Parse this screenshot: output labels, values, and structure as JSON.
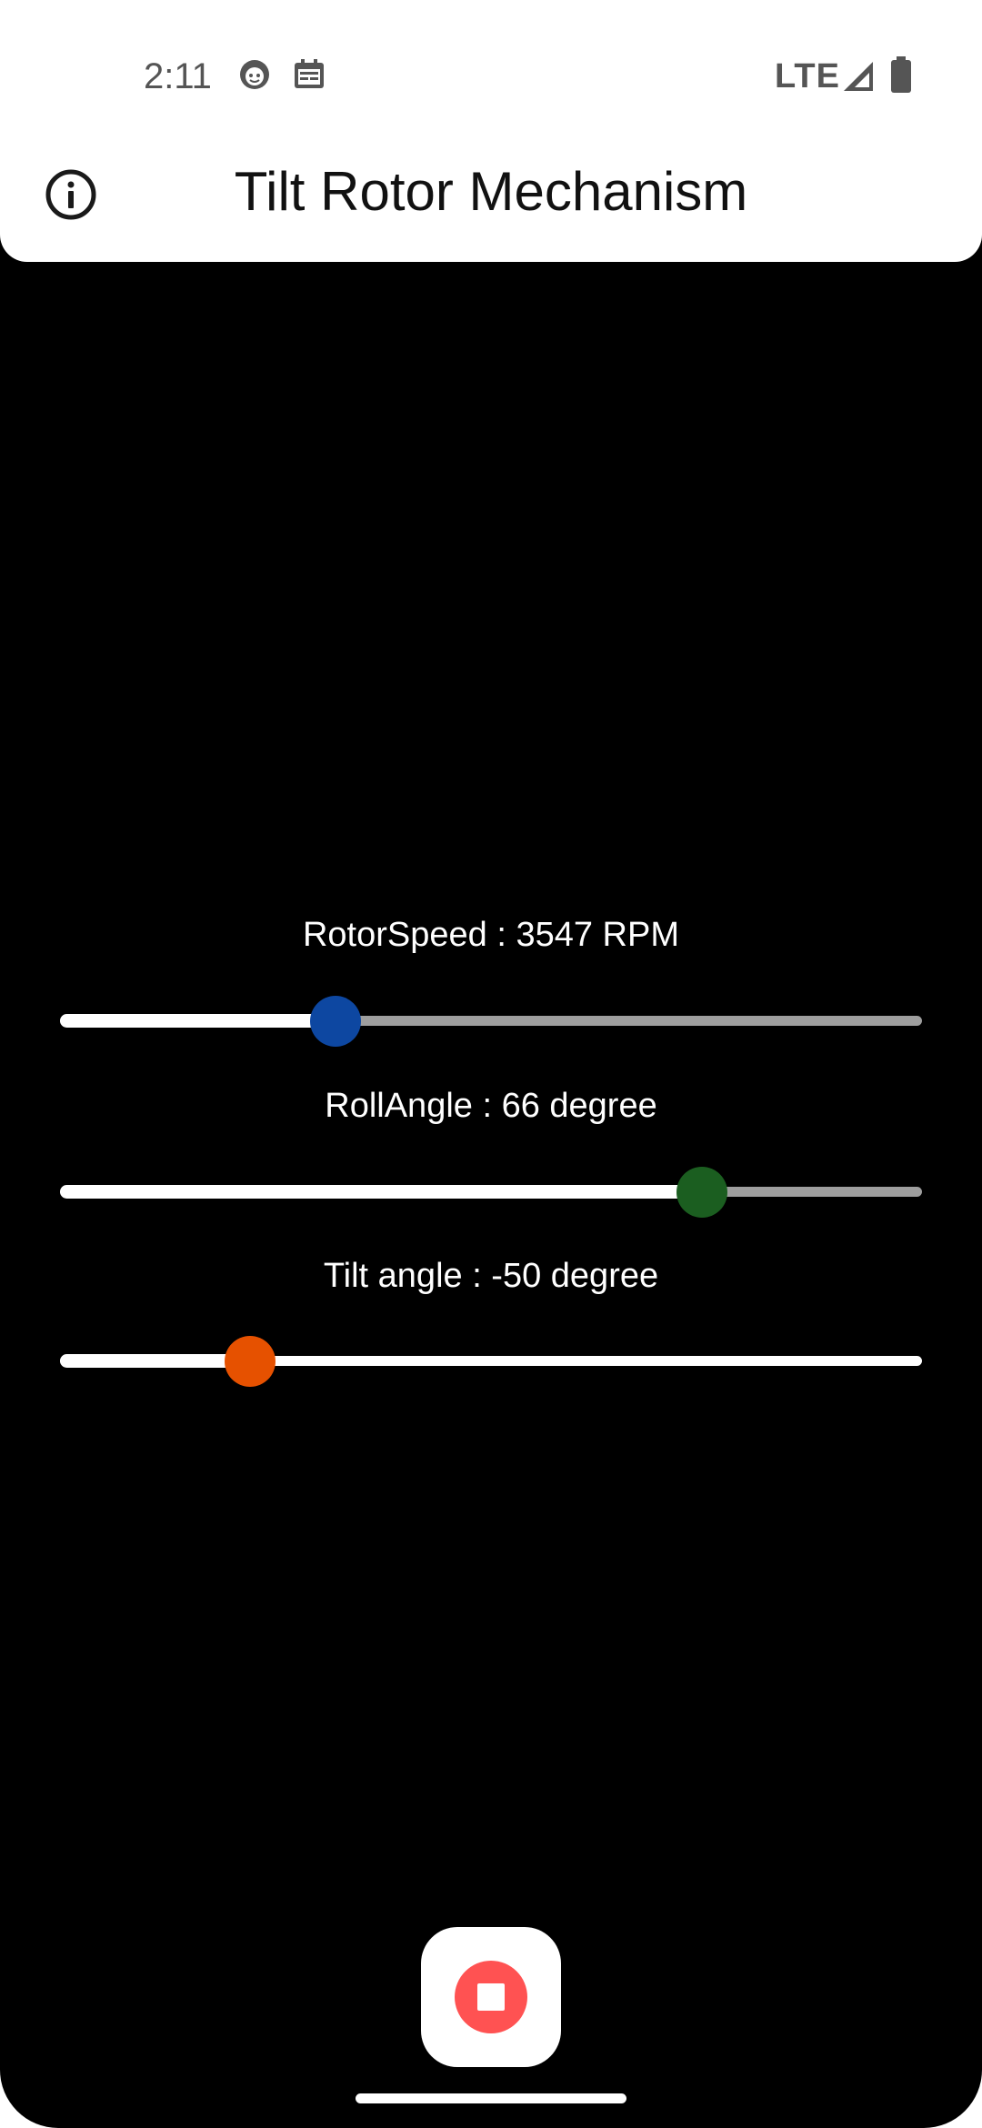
{
  "status_bar": {
    "time": "2:11",
    "network": "LTE",
    "icons": [
      "notification-face-icon",
      "calendar-icon",
      "signal-icon",
      "battery-icon"
    ]
  },
  "app_bar": {
    "title": "Tilt Rotor Mechanism",
    "info_icon": "info-icon"
  },
  "sliders": [
    {
      "label": "RotorSpeed :  3547 RPM",
      "value_fraction": 0.32,
      "thumb_color": "#0d47a1",
      "track_inactive": "#9e9e9e"
    },
    {
      "label": "RollAngle :  66 degree",
      "value_fraction": 0.745,
      "thumb_color": "#1b5e20",
      "track_inactive": "#9e9e9e"
    },
    {
      "label": "Tilt angle :  -50 degree",
      "value_fraction": 0.22,
      "thumb_color": "#e65100",
      "track_inactive": "#ffffff"
    }
  ],
  "stop_button": {
    "icon": "stop-icon",
    "color": "#ff5252"
  }
}
